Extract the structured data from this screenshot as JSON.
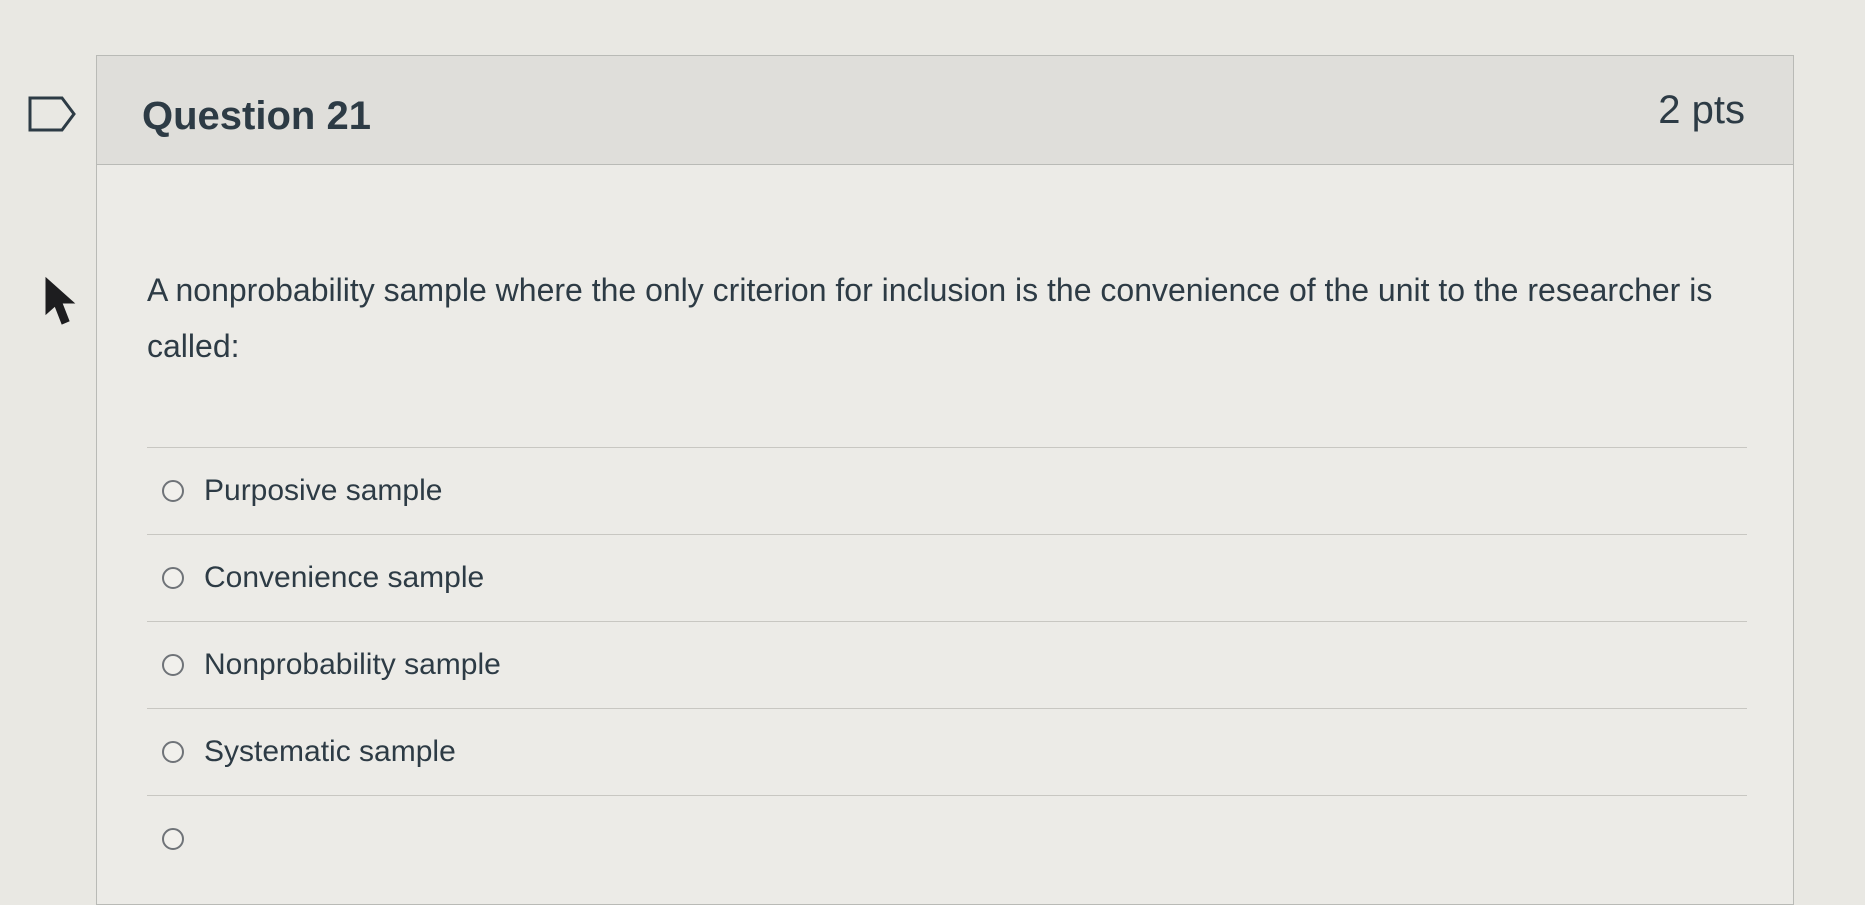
{
  "question": {
    "title": "Question 21",
    "points": "2 pts",
    "text": "A nonprobability sample where the only criterion for inclusion is the convenience of the unit to the researcher is called:"
  },
  "answers": [
    {
      "label": "Purposive sample"
    },
    {
      "label": "Convenience sample"
    },
    {
      "label": "Nonprobability sample"
    },
    {
      "label": "Systematic sample"
    },
    {
      "label": ""
    }
  ],
  "icons": {
    "flag": "flag-question-icon",
    "cursor": "mouse-pointer-icon"
  }
}
